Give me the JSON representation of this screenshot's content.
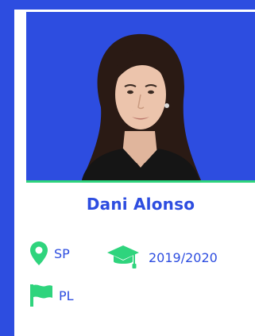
{
  "profile": {
    "name": "Dani Alonso",
    "state": "SP",
    "years": "2019/2020",
    "party": "PL"
  },
  "icons": {
    "location": "map-pin-icon",
    "education": "graduation-cap-icon",
    "party": "flag-icon"
  },
  "colors": {
    "brand_blue": "#2d4de0",
    "accent_green": "#2fd47d",
    "card": "#ffffff"
  }
}
